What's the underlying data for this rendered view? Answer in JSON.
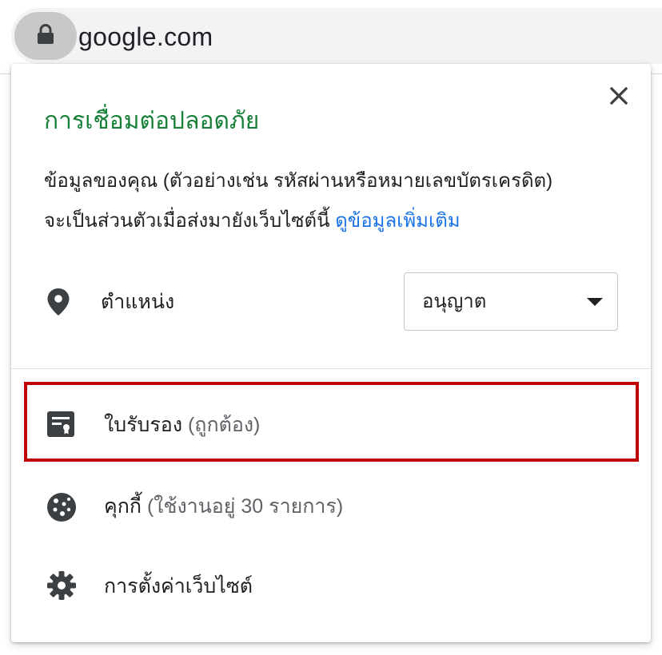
{
  "address_bar": {
    "url": "google.com",
    "lock_icon": "lock-icon"
  },
  "popup": {
    "title": "การเชื่อมต่อปลอดภัย",
    "description_line1": "ข้อมูลของคุณ (ตัวอย่างเช่น รหัสผ่านหรือหมายเลขบัตรเครดิต)",
    "description_line2": "จะเป็นส่วนตัวเมื่อส่งมายังเว็บไซต์นี้",
    "learn_more": "ดูข้อมูลเพิ่มเติม",
    "close_icon": "close-icon",
    "permission": {
      "icon": "location-pin-icon",
      "label": "ตำแหน่ง",
      "value": "อนุญาต"
    },
    "items": [
      {
        "icon": "certificate-icon",
        "label": "ใบรับรอง",
        "sub": "(ถูกต้อง)"
      },
      {
        "icon": "cookie-icon",
        "label": "คุกกี้",
        "sub": "(ใช้งานอยู่ 30 รายการ)"
      },
      {
        "icon": "gear-icon",
        "label": "การตั้งค่าเว็บไซต์",
        "sub": ""
      }
    ]
  },
  "colors": {
    "secure_title": "#188038",
    "link": "#1a73e8",
    "highlight": "#c00000"
  }
}
